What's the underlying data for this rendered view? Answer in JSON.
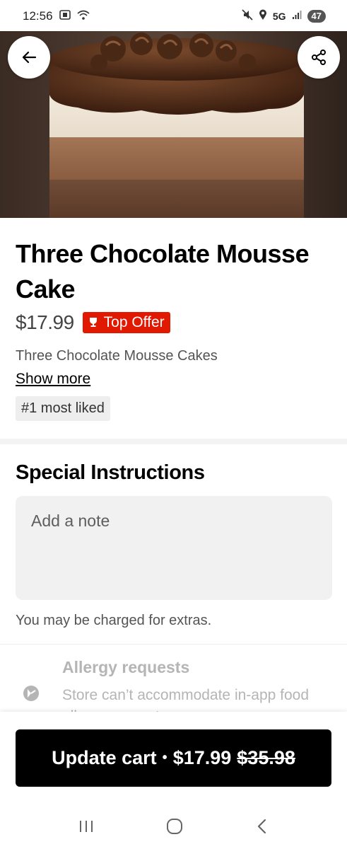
{
  "status_bar": {
    "time": "12:56",
    "network": "5G",
    "battery": "47"
  },
  "product": {
    "title": "Three Chocolate Mousse Cake",
    "price": "$17.99",
    "badge": "Top Offer",
    "description": "Three Chocolate Mousse Cakes",
    "show_more": "Show more",
    "tag": "#1 most liked"
  },
  "special_instructions": {
    "title": "Special Instructions",
    "placeholder": "Add a note",
    "charge_note": "You may be charged for extras."
  },
  "allergy": {
    "title": "Allergy requests",
    "text": "Store can’t accommodate in-app food allergy requests"
  },
  "cart": {
    "label": "Update cart",
    "separator": "•",
    "price": "$17.99",
    "old_price": "$35.98"
  },
  "colors": {
    "badge": "#e11900",
    "button": "#000000"
  },
  "icons": [
    "back-arrow-icon",
    "share-icon",
    "trophy-icon",
    "allergy-icon",
    "recent-apps-icon",
    "home-icon",
    "back-icon"
  ]
}
